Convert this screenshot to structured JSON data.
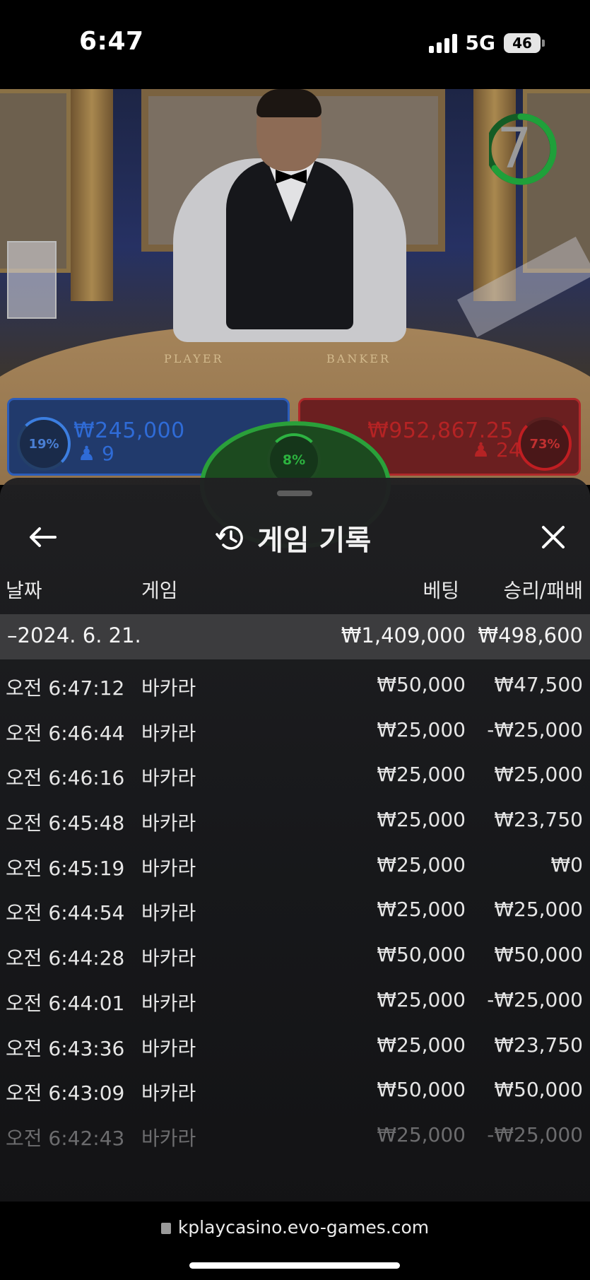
{
  "status_bar": {
    "time": "6:47",
    "network": "5G",
    "battery": "46"
  },
  "video": {
    "timer_value": "7",
    "table_labels": {
      "player": "PLAYER",
      "banker": "BANKER"
    },
    "player": {
      "percent": "19%",
      "amount": "₩245,000",
      "count": "9",
      "color": "#2f6bd6"
    },
    "tie": {
      "percent": "8%",
      "color": "#2cb33f"
    },
    "banker": {
      "percent": "73%",
      "amount": "₩952,867.25",
      "count": "24",
      "color": "#b52324"
    }
  },
  "history_sheet": {
    "title": "게임 기록",
    "icons": {
      "back": "arrow-left-icon",
      "history": "history-icon",
      "close": "close-icon"
    },
    "columns": {
      "date": "날짜",
      "game": "게임",
      "bet": "베팅",
      "win_loss": "승리/패배"
    },
    "summary": {
      "date": "–2024. 6. 21.",
      "bet": "₩1,409,000",
      "win_loss": "₩498,600"
    },
    "rows": [
      {
        "time": "오전 6:47:12",
        "game": "바카라",
        "bet": "₩50,000",
        "win_loss": "₩47,500"
      },
      {
        "time": "오전 6:46:44",
        "game": "바카라",
        "bet": "₩25,000",
        "win_loss": "-₩25,000"
      },
      {
        "time": "오전 6:46:16",
        "game": "바카라",
        "bet": "₩25,000",
        "win_loss": "₩25,000"
      },
      {
        "time": "오전 6:45:48",
        "game": "바카라",
        "bet": "₩25,000",
        "win_loss": "₩23,750"
      },
      {
        "time": "오전 6:45:19",
        "game": "바카라",
        "bet": "₩25,000",
        "win_loss": "₩0"
      },
      {
        "time": "오전 6:44:54",
        "game": "바카라",
        "bet": "₩25,000",
        "win_loss": "₩25,000"
      },
      {
        "time": "오전 6:44:28",
        "game": "바카라",
        "bet": "₩50,000",
        "win_loss": "₩50,000"
      },
      {
        "time": "오전 6:44:01",
        "game": "바카라",
        "bet": "₩25,000",
        "win_loss": "-₩25,000"
      },
      {
        "time": "오전 6:43:36",
        "game": "바카라",
        "bet": "₩25,000",
        "win_loss": "₩23,750"
      },
      {
        "time": "오전 6:43:09",
        "game": "바카라",
        "bet": "₩50,000",
        "win_loss": "₩50,000"
      },
      {
        "time": "오전 6:42:43",
        "game": "바카라",
        "bet": "₩25,000",
        "win_loss": "-₩25,000"
      }
    ]
  },
  "browser": {
    "url": "kplaycasino.evo-games.com"
  }
}
